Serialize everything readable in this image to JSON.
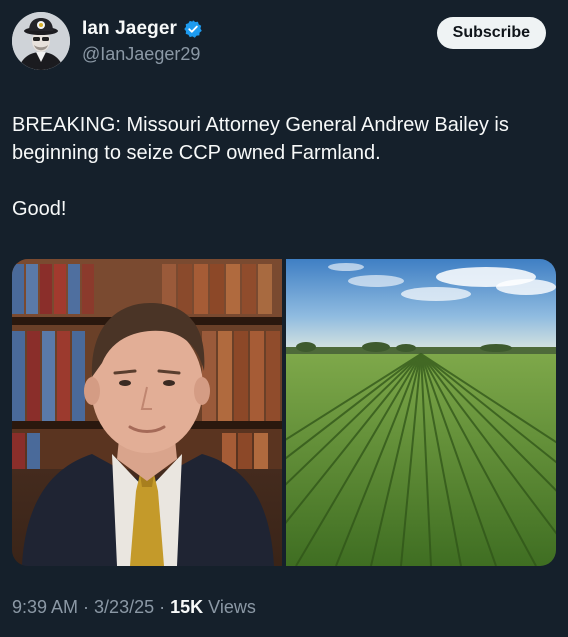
{
  "author": {
    "display_name": "Ian Jaeger",
    "handle": "@IanJaeger29",
    "verified": true,
    "avatar_icon": "profile-avatar"
  },
  "actions": {
    "subscribe_label": "Subscribe"
  },
  "tweet": {
    "text_line_1": "BREAKING: Missouri Attorney General Andrew Bailey is beginning to seize CCP owned Farmland.",
    "text_line_2": "Good!"
  },
  "media": [
    {
      "icon": "portrait-photo"
    },
    {
      "icon": "farmland-photo"
    }
  ],
  "meta": {
    "time": "9:39 AM",
    "sep1": " · ",
    "date": "3/23/25",
    "sep2": " · ",
    "views_count": "15K",
    "views_label": " Views"
  },
  "colors": {
    "background": "#15202b",
    "text_primary": "#f7f9f9",
    "text_secondary": "#8b98a5",
    "verified_blue": "#1d9bf0",
    "button_bg": "#eff3f4"
  }
}
